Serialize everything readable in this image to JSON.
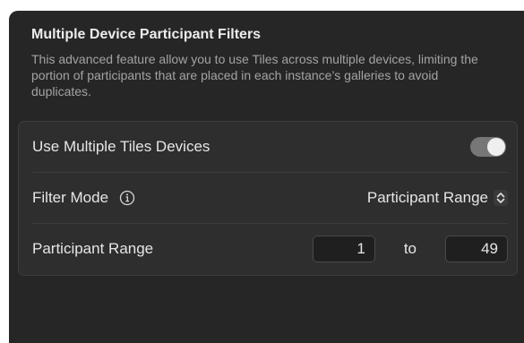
{
  "section": {
    "title": "Multiple Device Participant Filters",
    "description": "This advanced feature allow you to use Tiles across multiple devices, limiting the portion of participants that are placed in each instance’s galleries to avoid duplicates."
  },
  "rows": {
    "multiple_devices": {
      "label": "Use Multiple Tiles Devices",
      "enabled": true
    },
    "filter_mode": {
      "label": "Filter Mode",
      "info_icon": "info-icon",
      "selected": "Participant Range",
      "stepper_icon": "chevron-up-down-icon"
    },
    "participant_range": {
      "label": "Participant Range",
      "from": "1",
      "separator": "to",
      "to": "49"
    }
  },
  "colors": {
    "background": "#262626",
    "group": "#2e2e2e",
    "toggle_track": "#777777",
    "text": "#e6e6e6",
    "secondary_text": "#a3a3a3"
  }
}
